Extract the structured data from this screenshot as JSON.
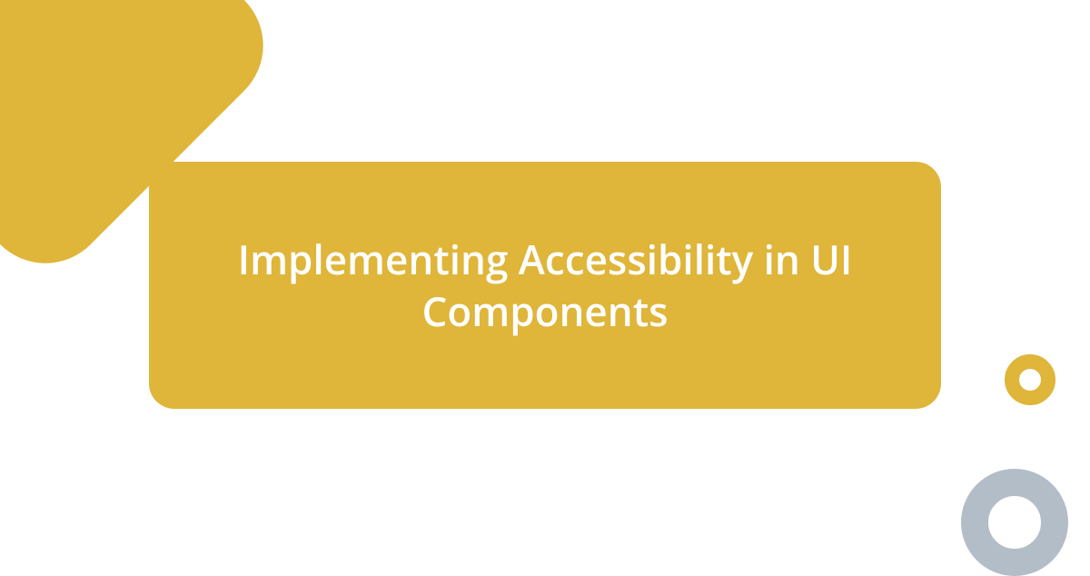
{
  "title": "Implementing Accessibility in UI Components",
  "colors": {
    "accent": "#dfb53a",
    "secondary": "#b3bdc8",
    "background": "#ffffff",
    "titleText": "#ffffff"
  }
}
